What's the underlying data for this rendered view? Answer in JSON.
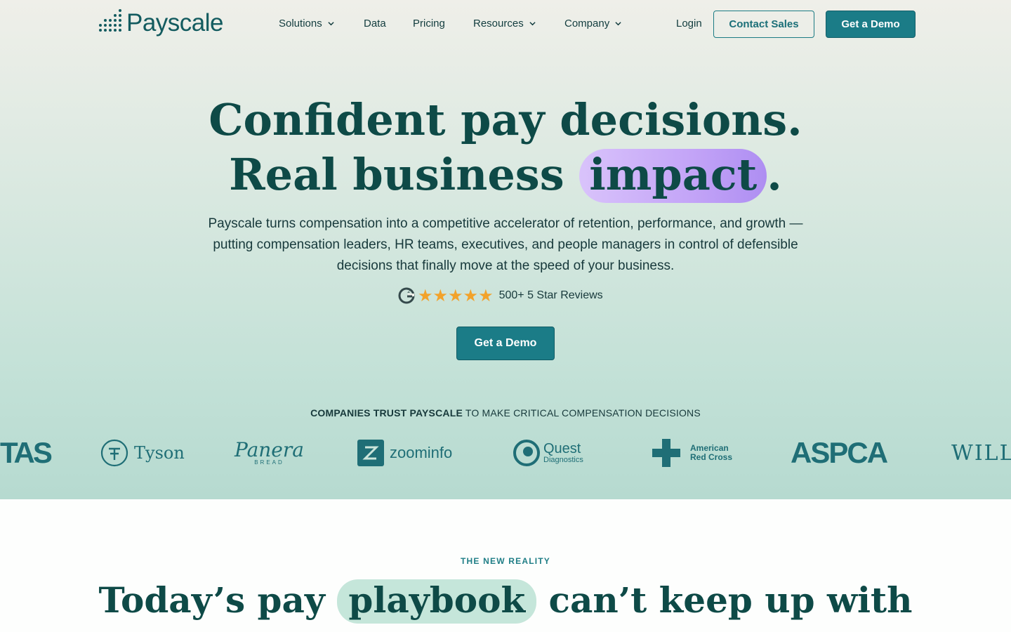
{
  "nav": {
    "logo_text": "Payscale",
    "items": [
      {
        "label": "Solutions",
        "has_dropdown": true
      },
      {
        "label": "Data",
        "has_dropdown": false
      },
      {
        "label": "Pricing",
        "has_dropdown": false
      },
      {
        "label": "Resources",
        "has_dropdown": true
      },
      {
        "label": "Company",
        "has_dropdown": true
      }
    ],
    "login": "Login",
    "contact_sales": "Contact Sales",
    "get_demo": "Get a Demo"
  },
  "hero": {
    "headline_line1": "Confident pay decisions.",
    "headline_line2_pre": "Real business",
    "headline_line2_highlight": "impact",
    "headline_line2_post": ".",
    "subtext": "Payscale turns compensation into a competitive accelerator of retention, performance, and growth — putting compensation leaders, HR teams, executives, and people managers in control of defensible decisions that finally move at the speed of your business.",
    "reviews": {
      "icon": "g2-icon",
      "stars": "★★★★★",
      "rating": 5,
      "text": "500+ 5 Star Reviews"
    },
    "cta": "Get a Demo"
  },
  "trust": {
    "bold": "COMPANIES TRUST PAYSCALE",
    "rest": " TO MAKE CRITICAL COMPENSATION DECISIONS",
    "logos": [
      "TAS",
      "Tyson",
      "Panera",
      "BREAD",
      "zoominfo",
      "Quest",
      "Diagnostics",
      "American",
      "Red Cross",
      "ASPCA",
      "WILL"
    ]
  },
  "section2": {
    "eyebrow": "THE NEW REALITY",
    "headline_pre": "Today’s pay",
    "headline_highlight": "playbook",
    "headline_post": "can’t keep up with"
  },
  "colors": {
    "brand_teal": "#1b7c87",
    "headline": "#0e4a47",
    "highlight_purple": "#c3a4f7",
    "highlight_mint": "#c5e6da",
    "star": "#f2a22b"
  }
}
